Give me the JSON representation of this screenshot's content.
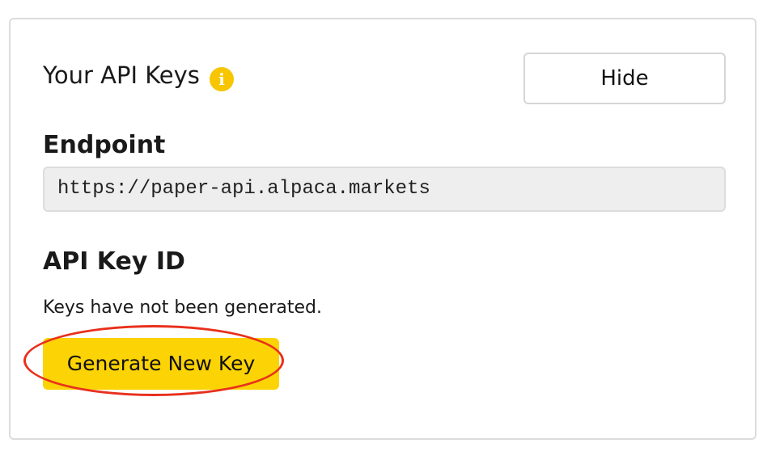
{
  "api_keys": {
    "title": "Your API Keys",
    "info_icon": "info-icon",
    "hide_label": "Hide",
    "endpoint_label": "Endpoint",
    "endpoint_value": "https://paper-api.alpaca.markets",
    "api_key_id_label": "API Key ID",
    "status_text": "Keys have not been generated.",
    "generate_label": "Generate New Key"
  },
  "colors": {
    "accent": "#fcd304",
    "info_icon": "#f7c600",
    "annotation": "#e8301c"
  }
}
